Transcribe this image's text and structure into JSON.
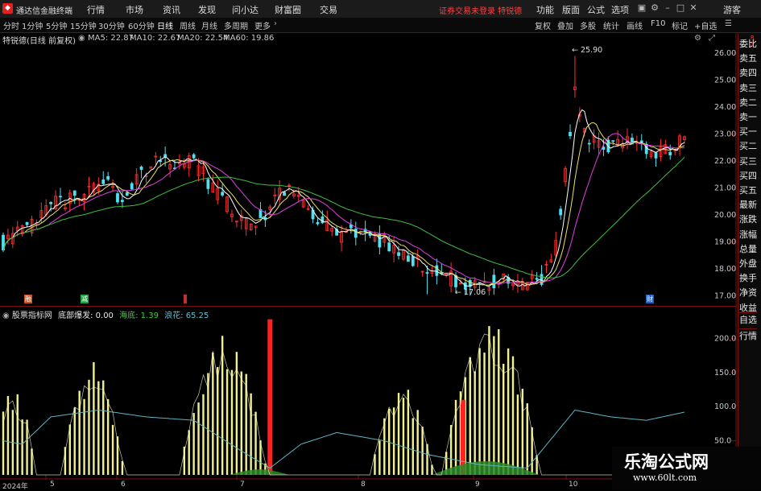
{
  "app": {
    "title": "通达信金融终端",
    "login_warning": "证券交易未登录  特锐德",
    "guest": "游客"
  },
  "menu": {
    "items": [
      "行情",
      "市场",
      "资讯",
      "发现",
      "问小达",
      "财富圈",
      "交易"
    ],
    "right_items": [
      "功能",
      "版面",
      "公式",
      "选项"
    ]
  },
  "toolbar": {
    "periods": [
      "分时",
      "1分钟",
      "5分钟",
      "15分钟",
      "30分钟",
      "60分钟",
      "日线",
      "周线",
      "月线",
      "多周期",
      "更多"
    ],
    "active_period": "日线",
    "tools": [
      "复权",
      "叠加",
      "多股",
      "统计",
      "画线",
      "F10",
      "标记",
      "+自选"
    ]
  },
  "stock": {
    "name": "特锐德(日线 前复权)",
    "ma": [
      {
        "label": "MA5: 22.87",
        "color": "#ffffff"
      },
      {
        "label": "MA10: 22.67",
        "color": "#f0e060"
      },
      {
        "label": "MA20: 22.54",
        "color": "#e040e0"
      },
      {
        "label": "MA60: 19.86",
        "color": "#40c040"
      }
    ]
  },
  "price_axis": {
    "labels": [
      "26.00",
      "25.00",
      "24.00",
      "23.00",
      "22.00",
      "21.00",
      "20.00",
      "19.00",
      "18.00",
      "17.00"
    ],
    "high": "25.90",
    "low": "17.06"
  },
  "sub": {
    "name": "股票指标网",
    "items": [
      {
        "label": "底部爆发: 0.00",
        "color": "#e8e8e8"
      },
      {
        "label": "海底: 1.39",
        "color": "#40d040"
      },
      {
        "label": "浪花: 65.25",
        "color": "#60c0d0"
      }
    ],
    "axis": [
      "200.0",
      "150.0",
      "100.0",
      "50.0"
    ]
  },
  "markers": [
    "融",
    "减",
    "财"
  ],
  "dates": [
    "2024年",
    "5",
    "6",
    "7",
    "8",
    "9",
    "10"
  ],
  "right_panel": [
    "委比",
    "卖五",
    "卖四",
    "卖三",
    "卖二",
    "卖一",
    "买一",
    "买二",
    "买三",
    "买四",
    "买五",
    "最新",
    "涨跌",
    "涨幅",
    "总量",
    "外盘",
    "换手",
    "净资",
    "收益",
    "自选",
    "行情"
  ],
  "watermark": {
    "title": "乐淘公式网",
    "url": "www.60lt.com"
  },
  "colors": {
    "up": "#ff3030",
    "down": "#50e0f0",
    "ma5": "#ffffff",
    "ma10": "#f0e060",
    "ma20": "#e040e0",
    "ma60": "#40c040",
    "bar": "#f0f090"
  }
}
